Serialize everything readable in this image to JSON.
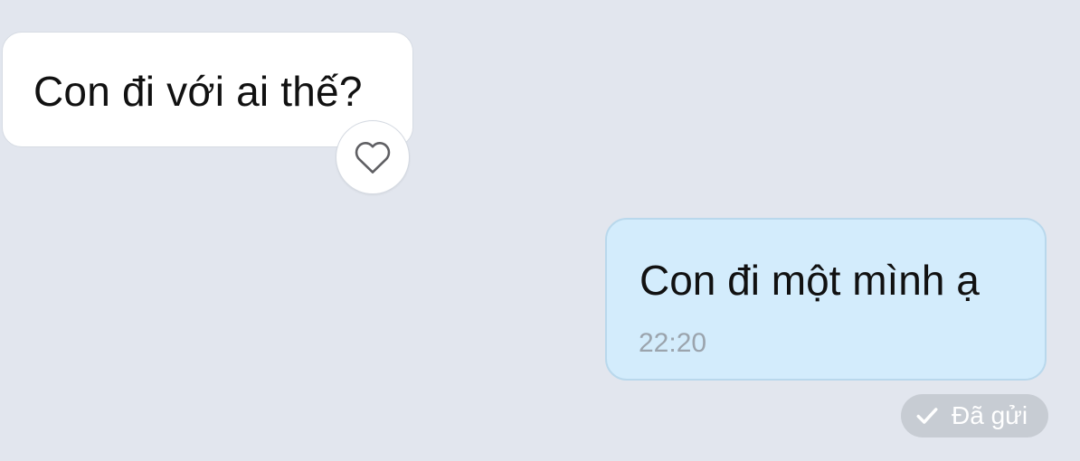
{
  "conversation": {
    "incoming": {
      "text": "Con đi với ai thế?",
      "reaction_icon": "heart-outline-icon"
    },
    "outgoing": {
      "text": "Con đi một mình ạ",
      "time": "22:20",
      "status": "Đã gửi",
      "status_icon": "checkmark-icon"
    }
  },
  "colors": {
    "background": "#e2e6ee",
    "incoming_bubble": "#ffffff",
    "outgoing_bubble": "#d3ecfc",
    "status_pill": "#c7ccd3",
    "timestamp": "#9ba4ad"
  }
}
